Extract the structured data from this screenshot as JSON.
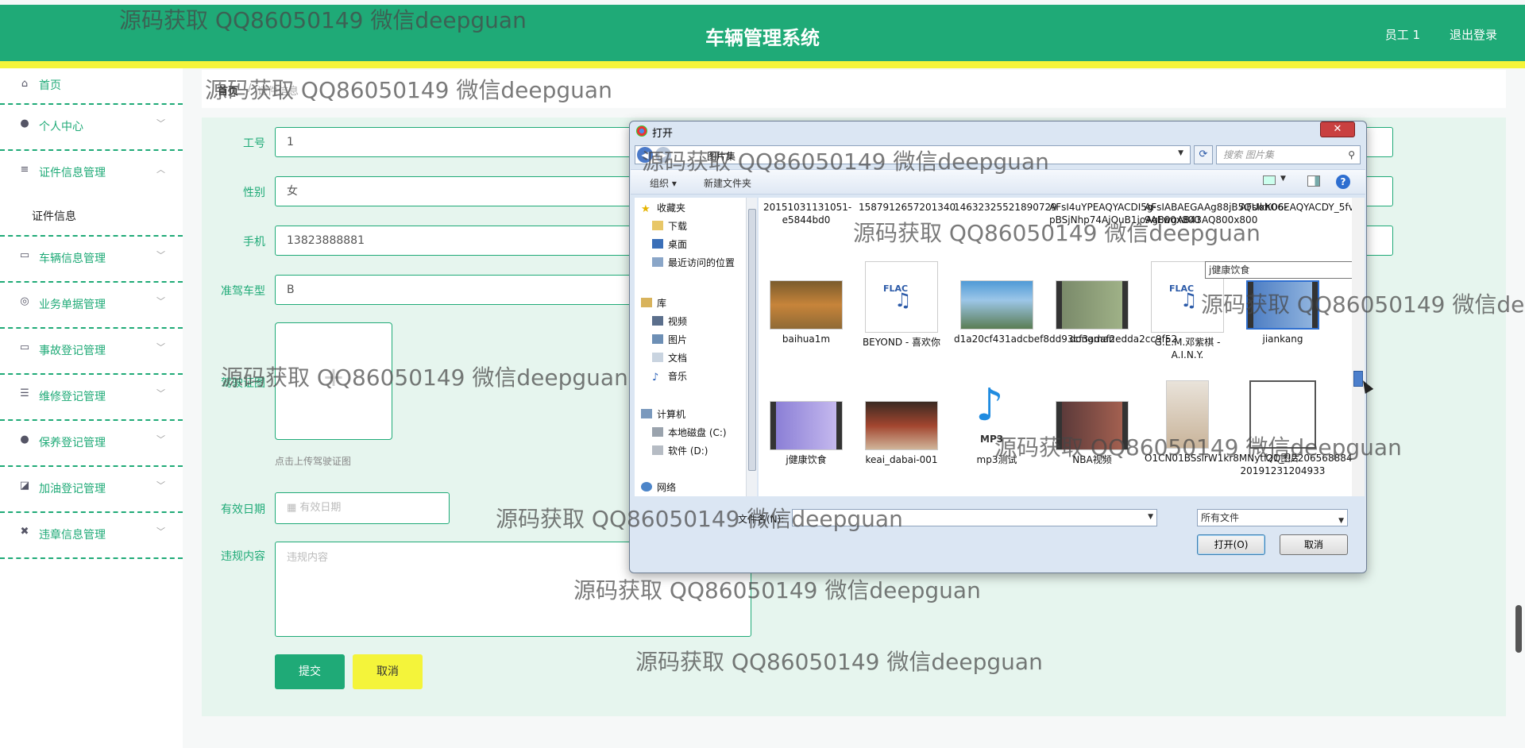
{
  "header": {
    "title": "车辆管理系统",
    "user": "员工 1",
    "logout": "退出登录"
  },
  "sidebar": {
    "items": [
      {
        "label": "首页",
        "icon": "home-icon",
        "glyph": "⌂"
      },
      {
        "label": "个人中心",
        "icon": "person-icon",
        "glyph": "●"
      },
      {
        "label": "证件信息管理",
        "icon": "menu-icon",
        "glyph": "≡"
      },
      {
        "label": "车辆信息管理",
        "icon": "chat-icon",
        "glyph": "▭"
      },
      {
        "label": "业务单据管理",
        "icon": "compass-icon",
        "glyph": "◎"
      },
      {
        "label": "事故登记管理",
        "icon": "chat-icon",
        "glyph": "▭"
      },
      {
        "label": "维修登记管理",
        "icon": "list-icon",
        "glyph": "☰"
      },
      {
        "label": "保养登记管理",
        "icon": "person-icon",
        "glyph": "●"
      },
      {
        "label": "加油登记管理",
        "icon": "chart-icon",
        "glyph": "◪"
      },
      {
        "label": "违章信息管理",
        "icon": "delete-icon",
        "glyph": "✖"
      }
    ],
    "sub_item": "证件信息"
  },
  "breadcrumb": {
    "home": "首页",
    "separator": "/",
    "current": "证件信息"
  },
  "form": {
    "fields": {
      "employee_no": {
        "label": "工号",
        "value": "1"
      },
      "gender": {
        "label": "性别",
        "value": "女"
      },
      "phone": {
        "label": "手机",
        "value": "13823888881"
      },
      "license_type": {
        "label": "准驾车型",
        "value": "B"
      },
      "license_photo": {
        "label": "驾驶证图",
        "hint": "点击上传驾驶证图"
      },
      "valid_date": {
        "label": "有效日期",
        "placeholder": "有效日期"
      },
      "violation": {
        "label": "违规内容",
        "placeholder": "违规内容"
      }
    },
    "submit": "提交",
    "cancel": "取消"
  },
  "dialog": {
    "title": "打开",
    "close": "✕",
    "path": "图片集",
    "search_placeholder": "搜索 图片集",
    "organize": "组织 ▾",
    "new_folder": "新建文件夹",
    "nav": [
      {
        "label": "收藏夹",
        "icon": "star-icon"
      },
      {
        "label": "下载",
        "icon": "download-folder-icon"
      },
      {
        "label": "桌面",
        "icon": "desktop-icon"
      },
      {
        "label": "最近访问的位置",
        "icon": "recent-icon"
      },
      {
        "label": "库",
        "icon": "library-icon"
      },
      {
        "label": "视频",
        "icon": "video-icon"
      },
      {
        "label": "图片",
        "icon": "pictures-icon"
      },
      {
        "label": "文档",
        "icon": "documents-icon"
      },
      {
        "label": "音乐",
        "icon": "music-icon"
      },
      {
        "label": "计算机",
        "icon": "computer-icon"
      },
      {
        "label": "本地磁盘 (C:)",
        "icon": "disk-icon"
      },
      {
        "label": "软件 (D:)",
        "icon": "disk-icon"
      },
      {
        "label": "网络",
        "icon": "network-icon"
      }
    ],
    "files_row1": [
      "20151031131051-e5844bd0",
      "1587912657201340",
      "14632325521890729",
      "AFsI4uYPEAQYACDI5g-pBSjNhp74AjQuB1joAg800x800",
      "AFsIABAEGAAg88jB5QUohO6-9AEwgA843AQ800x800",
      "AFsIkK06EAQYACDY_5fvBSjO1vLkBTDIATjIAQ!450x450.png.we..."
    ],
    "files_row2": [
      {
        "name": "baihua1m",
        "thumb": "photo"
      },
      {
        "name": "BEYOND - 喜欢你",
        "thumb": "flac",
        "tag": "FLAC"
      },
      {
        "name": "d1a20cf431adcbef8dd93cf3adaf2edda2cc9f52",
        "thumb": "photo"
      },
      {
        "name": "dongman",
        "thumb": "video"
      },
      {
        "name": "G.E.M.邓紫棋 - A.I.N.Y.",
        "thumb": "flac",
        "tag": "FLAC"
      },
      {
        "name": "jiankang",
        "thumb": "video"
      }
    ],
    "files_row3": [
      {
        "name": "j健康饮食",
        "thumb": "video"
      },
      {
        "name": "keai_dabai-001",
        "thumb": "photo"
      },
      {
        "name": "mp3测试",
        "thumb": "mp3",
        "tag": "MP3"
      },
      {
        "name": "NBA视频",
        "thumb": "video"
      },
      {
        "name": "O1CN01BSslrW1kr8MNytf21_!!2206568884736",
        "thumb": "photo"
      },
      {
        "name": "QQ图片20191231204933",
        "thumb": "blank"
      }
    ],
    "tooltip": "j健康饮食",
    "filename_label": "文件名(N):",
    "filetype": "所有文件",
    "open": "打开(O)",
    "cancel": "取消"
  },
  "watermark": "源码获取 QQ86050149 微信deepguan",
  "colors": {
    "primary": "#1faa77",
    "accent": "#f4f43a"
  }
}
